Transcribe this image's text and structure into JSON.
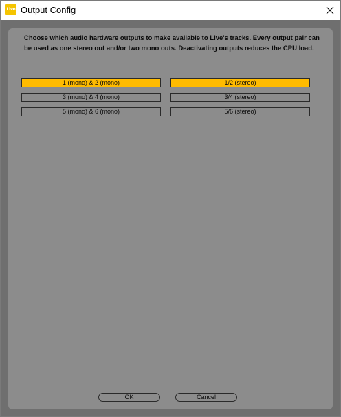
{
  "window": {
    "title": "Output Config",
    "app_icon_text": "Live"
  },
  "description": "Choose which audio hardware outputs to make available to Live's tracks. Every output pair can be used as one stereo out and/or two mono outs.  Deactivating outputs reduces the CPU load.",
  "outputs": {
    "mono": [
      {
        "label": "1 (mono) & 2 (mono)",
        "active": true
      },
      {
        "label": "3 (mono) & 4 (mono)",
        "active": false
      },
      {
        "label": "5 (mono) & 6 (mono)",
        "active": false
      }
    ],
    "stereo": [
      {
        "label": "1/2 (stereo)",
        "active": true
      },
      {
        "label": "3/4 (stereo)",
        "active": false
      },
      {
        "label": "5/6 (stereo)",
        "active": false
      }
    ]
  },
  "buttons": {
    "ok_label": "OK",
    "cancel_label": "Cancel"
  },
  "colors": {
    "active_toggle": "#ffbb00",
    "panel": "#8c8c8c",
    "frame": "#6f6f6f",
    "app_icon": "#f5c400"
  },
  "icons": {
    "close": "close-icon",
    "app": "ableton-live-icon"
  }
}
